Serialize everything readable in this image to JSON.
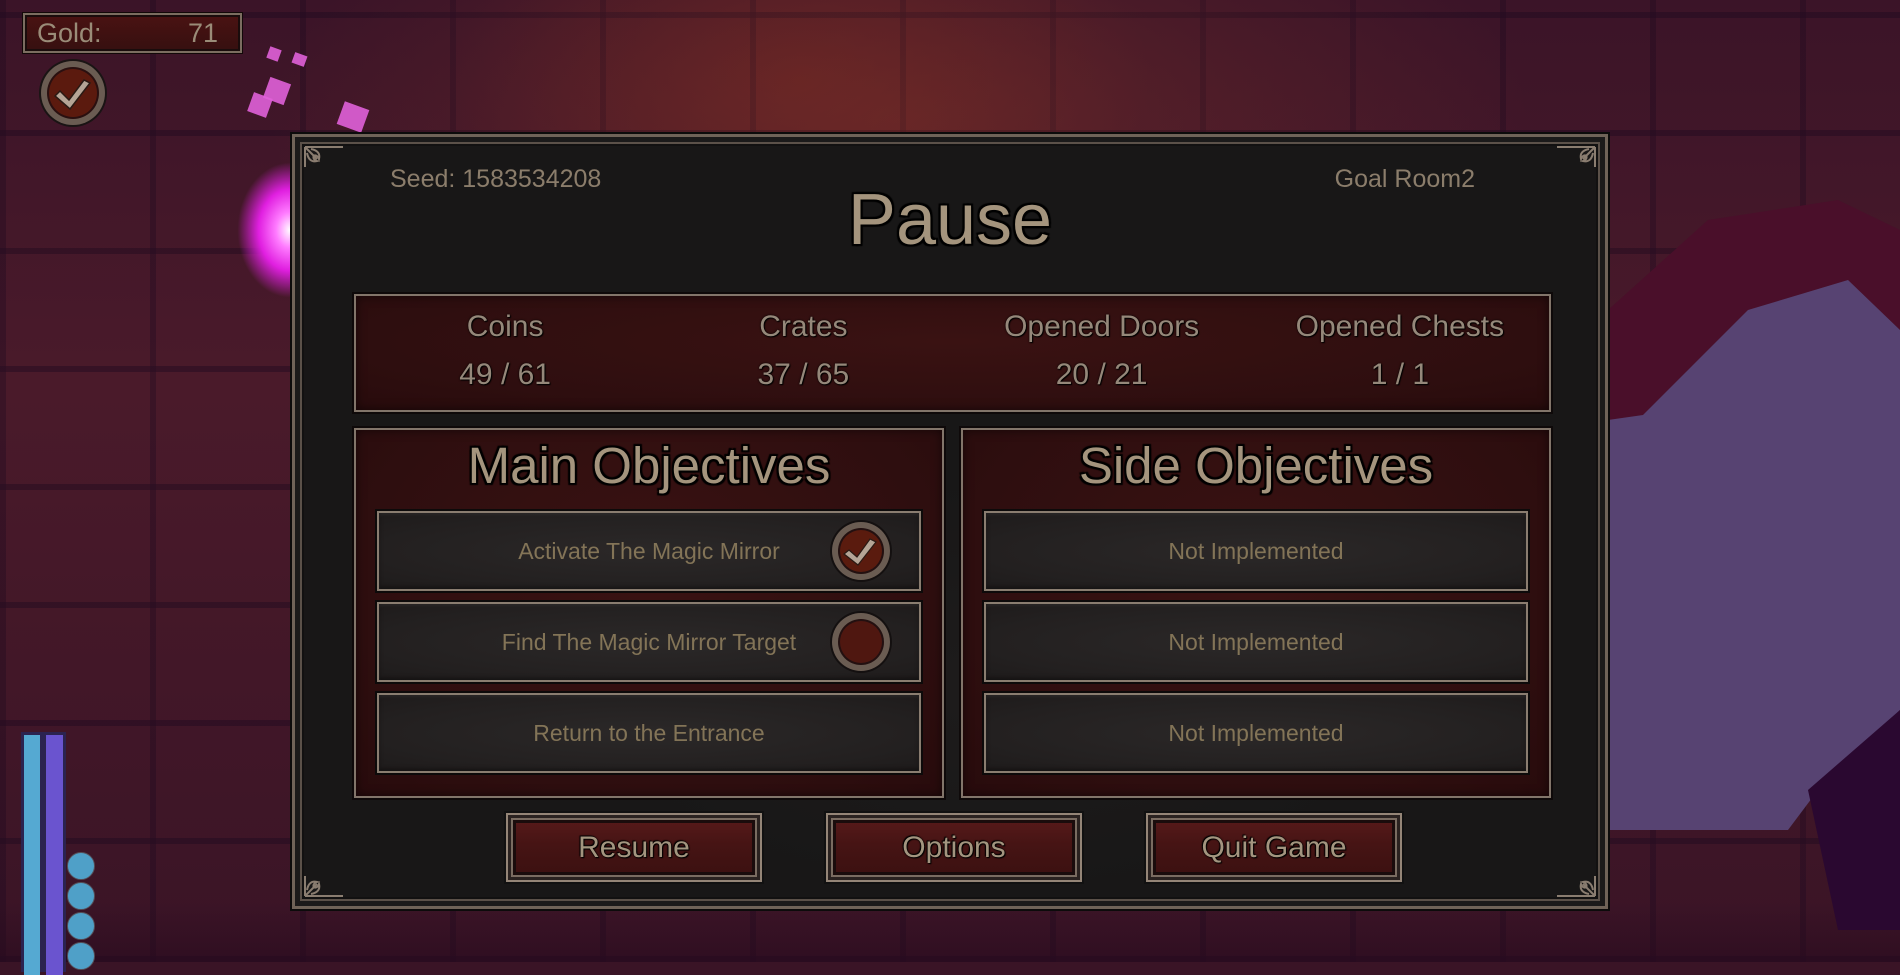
{
  "hud": {
    "gold_label": "Gold:",
    "gold_value": "71",
    "objective_icon": "checkmark-icon",
    "orbs": 4
  },
  "pause": {
    "seed": "Seed: 1583534208",
    "goal": "Goal Room2",
    "title": "Pause",
    "stats": [
      {
        "label": "Coins",
        "value": "49 / 61"
      },
      {
        "label": "Crates",
        "value": "37 / 65"
      },
      {
        "label": "Opened Doors",
        "value": "20 / 21"
      },
      {
        "label": "Opened Chests",
        "value": "1 / 1"
      }
    ],
    "main_objectives": {
      "title": "Main Objectives",
      "items": [
        {
          "label": "Activate The Magic Mirror",
          "status": "complete"
        },
        {
          "label": "Find The Magic Mirror Target",
          "status": "incomplete"
        },
        {
          "label": "Return to the Entrance",
          "status": "none"
        }
      ]
    },
    "side_objectives": {
      "title": "Side Objectives",
      "items": [
        {
          "label": "Not Implemented"
        },
        {
          "label": "Not Implemented"
        },
        {
          "label": "Not Implemented"
        }
      ]
    },
    "buttons": {
      "resume": "Resume",
      "options": "Options",
      "quit": "Quit Game"
    }
  },
  "colors": {
    "panel_bg": "#181717",
    "red_box": "#2e0e0f",
    "text_tan": "#a4947d",
    "frame": "#82756a",
    "mana_bar": "#55a9d2",
    "stamina_bar": "#6a54cf"
  }
}
